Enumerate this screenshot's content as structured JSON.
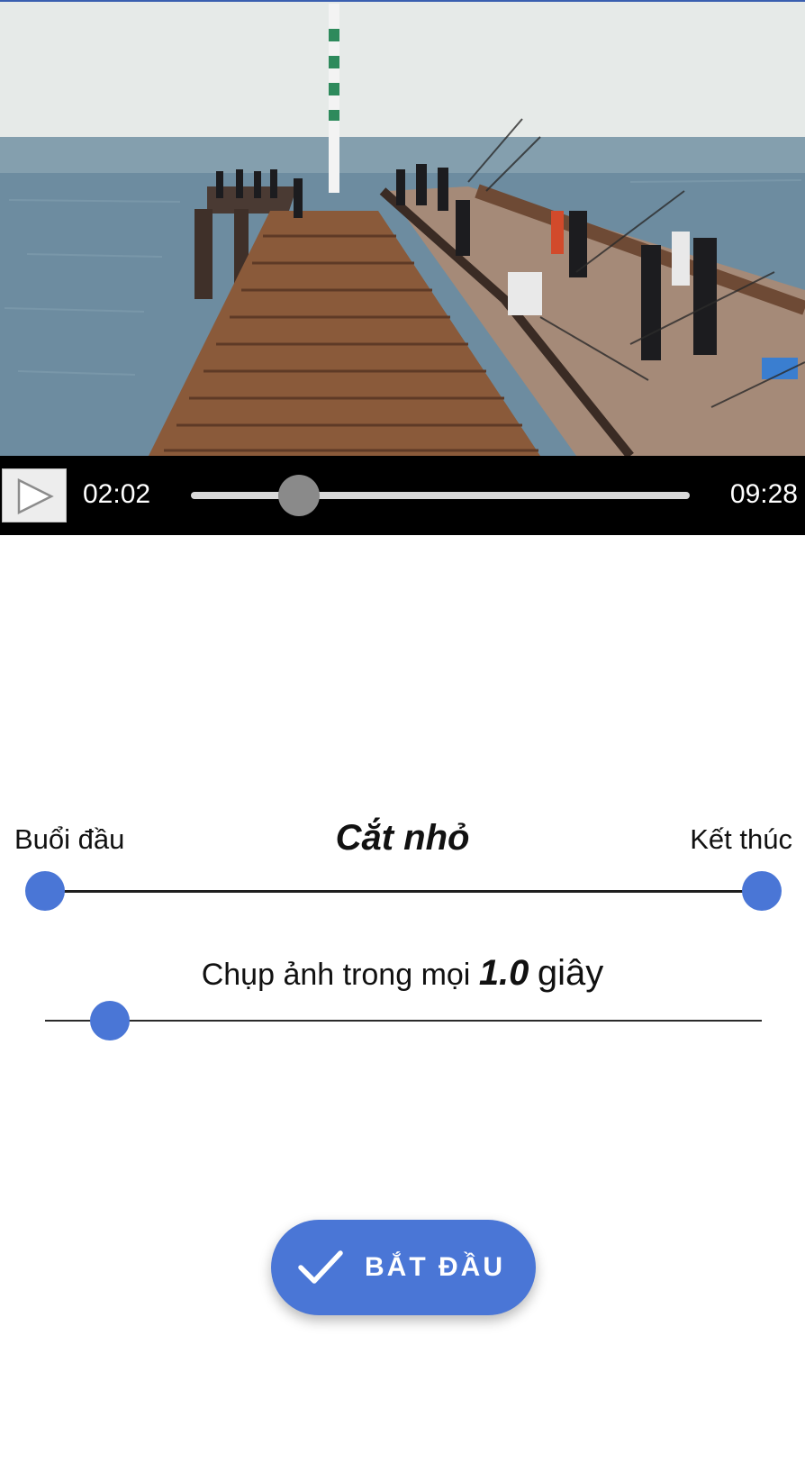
{
  "video": {
    "current_time": "02:02",
    "total_time": "09:28",
    "progress": 0.216,
    "play_icon": "play-icon"
  },
  "range": {
    "start_label": "Buổi đầu",
    "title": "Cắt nhỏ",
    "end_label": "Kết thúc",
    "start_fraction": 0.0,
    "end_fraction": 1.0
  },
  "interval": {
    "prefix": "Chụp ảnh trong mọi",
    "value": "1.0",
    "unit": "giây",
    "slider_fraction": 0.09
  },
  "action": {
    "start_label": "BẮT ĐẦU",
    "icon": "check-icon"
  },
  "colors": {
    "accent": "#4a76d6",
    "seek_thumb": "#8a8a8a",
    "control_bar": "#000000"
  }
}
